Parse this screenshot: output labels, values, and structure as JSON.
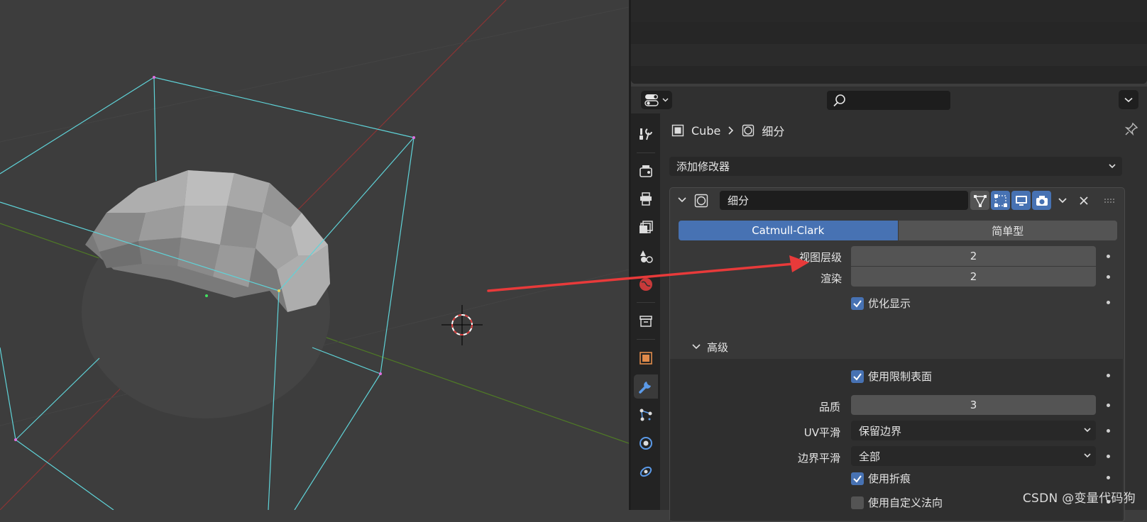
{
  "breadcrumb": {
    "object": "Cube",
    "modifier": "细分"
  },
  "add_modifier": {
    "label": "添加修改器"
  },
  "modifier": {
    "name": "细分",
    "algorithm": {
      "options": [
        "Catmull-Clark",
        "简单型"
      ],
      "selected": "Catmull-Clark"
    },
    "viewport_levels": {
      "label": "视图层级",
      "value": "2"
    },
    "render_levels": {
      "label": "渲染",
      "value": "2"
    },
    "optimal_display": {
      "label": "优化显示",
      "checked": true
    },
    "advanced": {
      "label": "高级",
      "use_limit_surface": {
        "label": "使用限制表面",
        "checked": true
      },
      "quality": {
        "label": "品质",
        "value": "3"
      },
      "uv_smooth": {
        "label": "UV平滑",
        "value": "保留边界"
      },
      "boundary_smooth": {
        "label": "边界平滑",
        "value": "全部"
      },
      "use_creases": {
        "label": "使用折痕",
        "checked": true
      },
      "use_custom_normals": {
        "label": "使用自定义法向",
        "checked": false
      }
    }
  },
  "icons": {
    "tabs": [
      "tool-icon",
      "render-icon",
      "output-icon",
      "view-layer-icon",
      "scene-icon",
      "world-icon",
      "collection-icon",
      "object-icon",
      "modifier-icon",
      "particles-icon",
      "physics-icon",
      "constraints-icon"
    ],
    "active_tab": "modifier-icon"
  },
  "colors": {
    "accent": "#4772b3",
    "wire": "#5fd3d8",
    "x_axis": "#9e3838",
    "y_axis": "#5a8a2a",
    "annotation_arrow": "#e83a3a"
  },
  "watermark": "CSDN @变量代码狗"
}
